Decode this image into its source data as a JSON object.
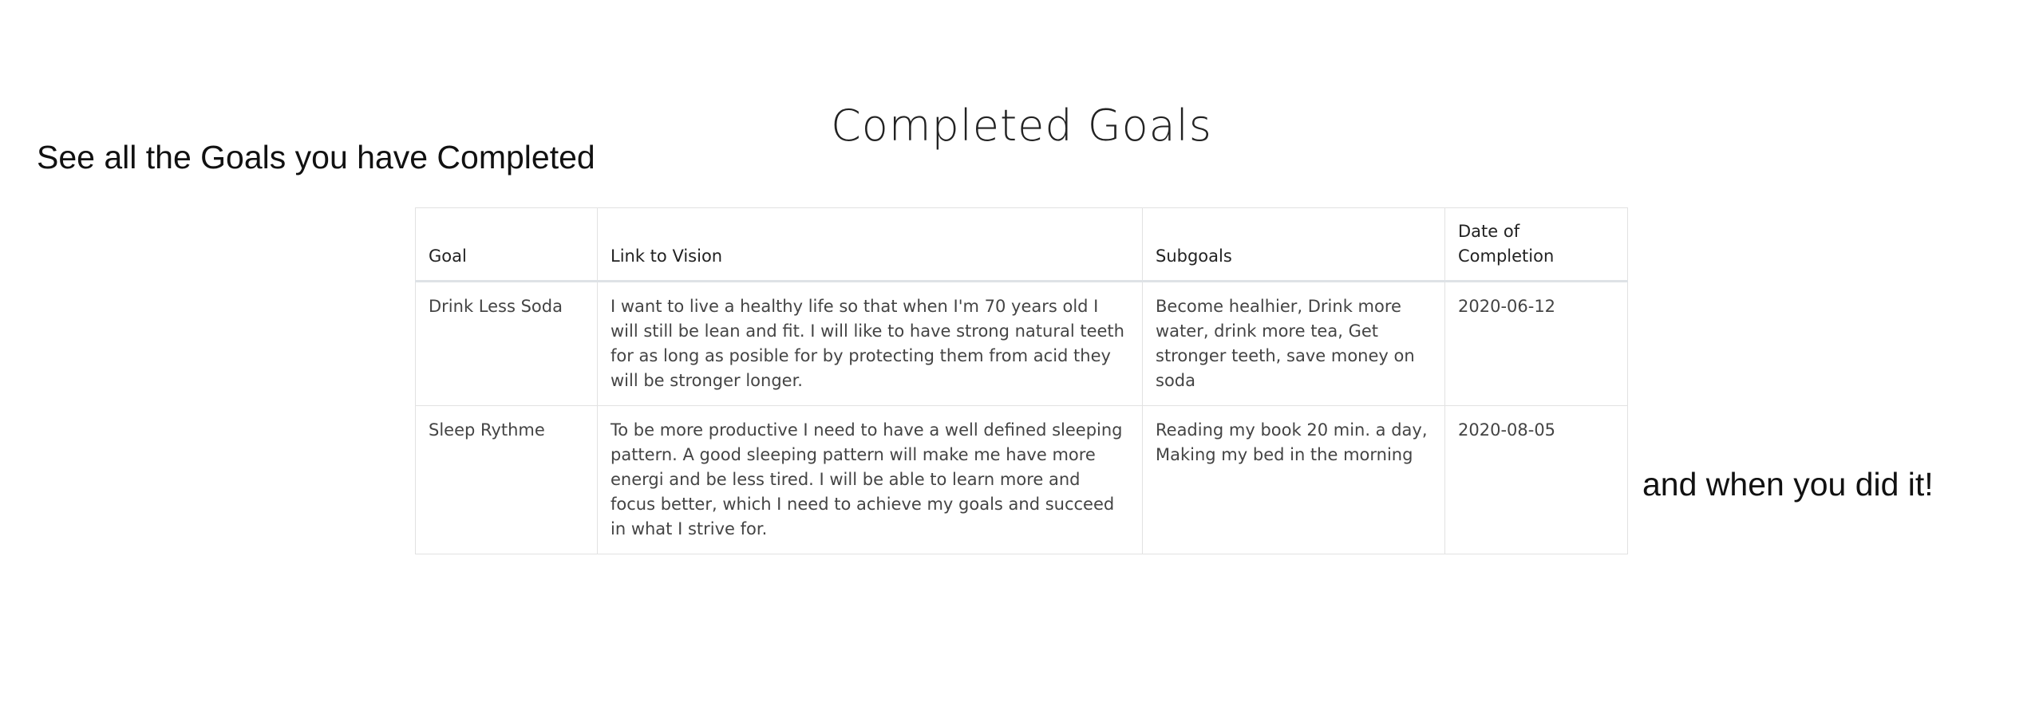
{
  "page": {
    "title": "Completed Goals",
    "caption_left": "See all the Goals you have Completed",
    "caption_right": "and when you did it!"
  },
  "table": {
    "headers": {
      "goal": "Goal",
      "vision": "Link to Vision",
      "subgoals": "Subgoals",
      "date": "Date of Completion"
    },
    "rows": [
      {
        "goal": "Drink Less Soda",
        "vision": "I want to live a healthy life so that when I'm 70 years old I will still be lean and fit. I will like to have strong natural teeth for as long as posible for by protecting them from acid they will be stronger longer.",
        "subgoals": "Become healhier, Drink more water, drink more tea, Get stronger teeth, save money on soda",
        "date": "2020-06-12"
      },
      {
        "goal": "Sleep Rythme",
        "vision": "To be more productive I need to have a well defined sleeping pattern. A good sleeping pattern will make me have more energi and be less tired. I will be able to learn more and focus better, which I need to achieve my goals and succeed in what I strive for.",
        "subgoals": "Reading my book 20 min. a day, Making my bed in the morning",
        "date": "2020-08-05"
      }
    ]
  }
}
